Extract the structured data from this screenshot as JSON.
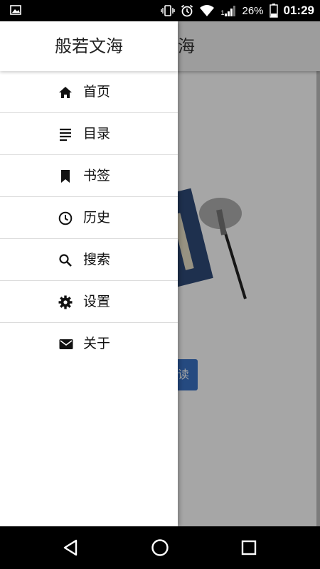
{
  "status_bar": {
    "battery_percent": "26%",
    "time": "01:29",
    "signal_sim": "1",
    "icons": [
      "gallery-icon",
      "vibrate-icon",
      "alarm-icon",
      "wifi-icon",
      "signal-icon",
      "battery-icon"
    ]
  },
  "app": {
    "title_visible": "海",
    "read_button_visible": "读"
  },
  "drawer": {
    "title": "般若文海",
    "items": [
      {
        "label": "首页",
        "icon": "home-icon"
      },
      {
        "label": "目录",
        "icon": "list-icon"
      },
      {
        "label": "书签",
        "icon": "bookmark-icon"
      },
      {
        "label": "历史",
        "icon": "history-icon"
      },
      {
        "label": "搜索",
        "icon": "search-icon"
      },
      {
        "label": "设置",
        "icon": "gear-icon"
      },
      {
        "label": "关于",
        "icon": "mail-icon"
      }
    ]
  },
  "colors": {
    "status_bar": "#000000",
    "drawer_bg": "#ffffff",
    "read_button": "#3a72c5",
    "divider": "#dcdcdc"
  }
}
